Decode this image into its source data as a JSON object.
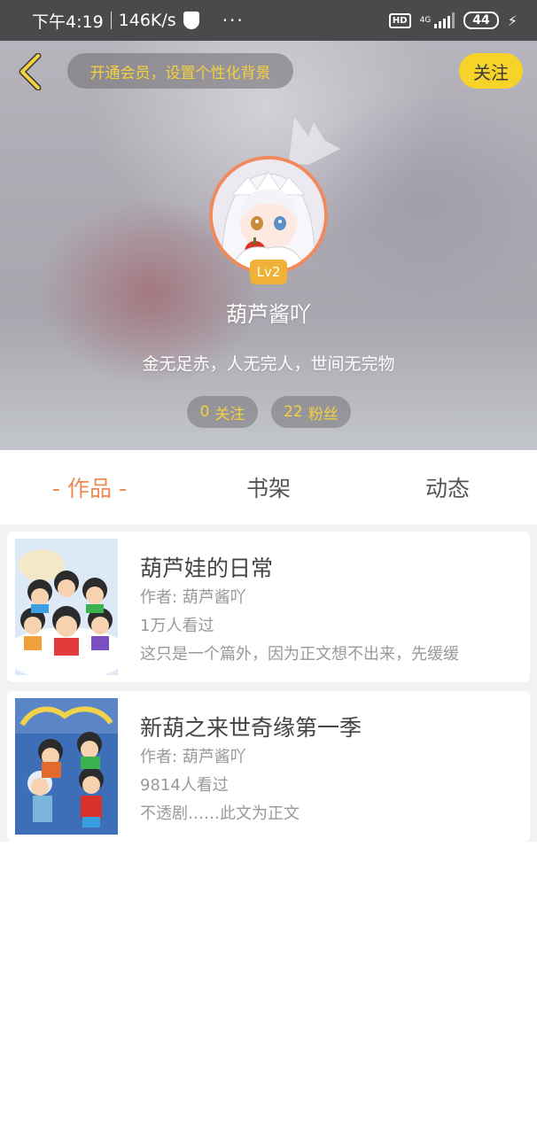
{
  "status_bar": {
    "time": "下午4:19",
    "speed": "146K/s",
    "more": "···",
    "hd": "HD",
    "network": "4G",
    "battery": "44"
  },
  "header": {
    "vip_banner": "开通会员，设置个性化背景",
    "follow_label": "关注"
  },
  "profile": {
    "level": "Lv2",
    "username": "葫芦酱吖",
    "motto": "金无足赤，人无完人，世间无完物",
    "following_count": "0",
    "following_label": "关注",
    "fans_count": "22",
    "fans_label": "粉丝"
  },
  "tabs": [
    {
      "label": "- 作品 -",
      "active": true
    },
    {
      "label": "书架",
      "active": false
    },
    {
      "label": "动态",
      "active": false
    }
  ],
  "works": [
    {
      "title": "葫芦娃的日常",
      "author": "作者: 葫芦酱吖",
      "views": "1万人看过",
      "description": "这只是一个篇外，因为正文想不出来，先缓缓"
    },
    {
      "title": "新葫之来世奇缘第一季",
      "author": "作者: 葫芦酱吖",
      "views": "9814人看过",
      "description": "不透剧……此文为正文"
    }
  ],
  "colors": {
    "accent_orange": "#ef8b52",
    "follow_yellow": "#f7d32a",
    "pill_text_yellow": "#f5d23d",
    "level_badge": "#f0b236"
  }
}
